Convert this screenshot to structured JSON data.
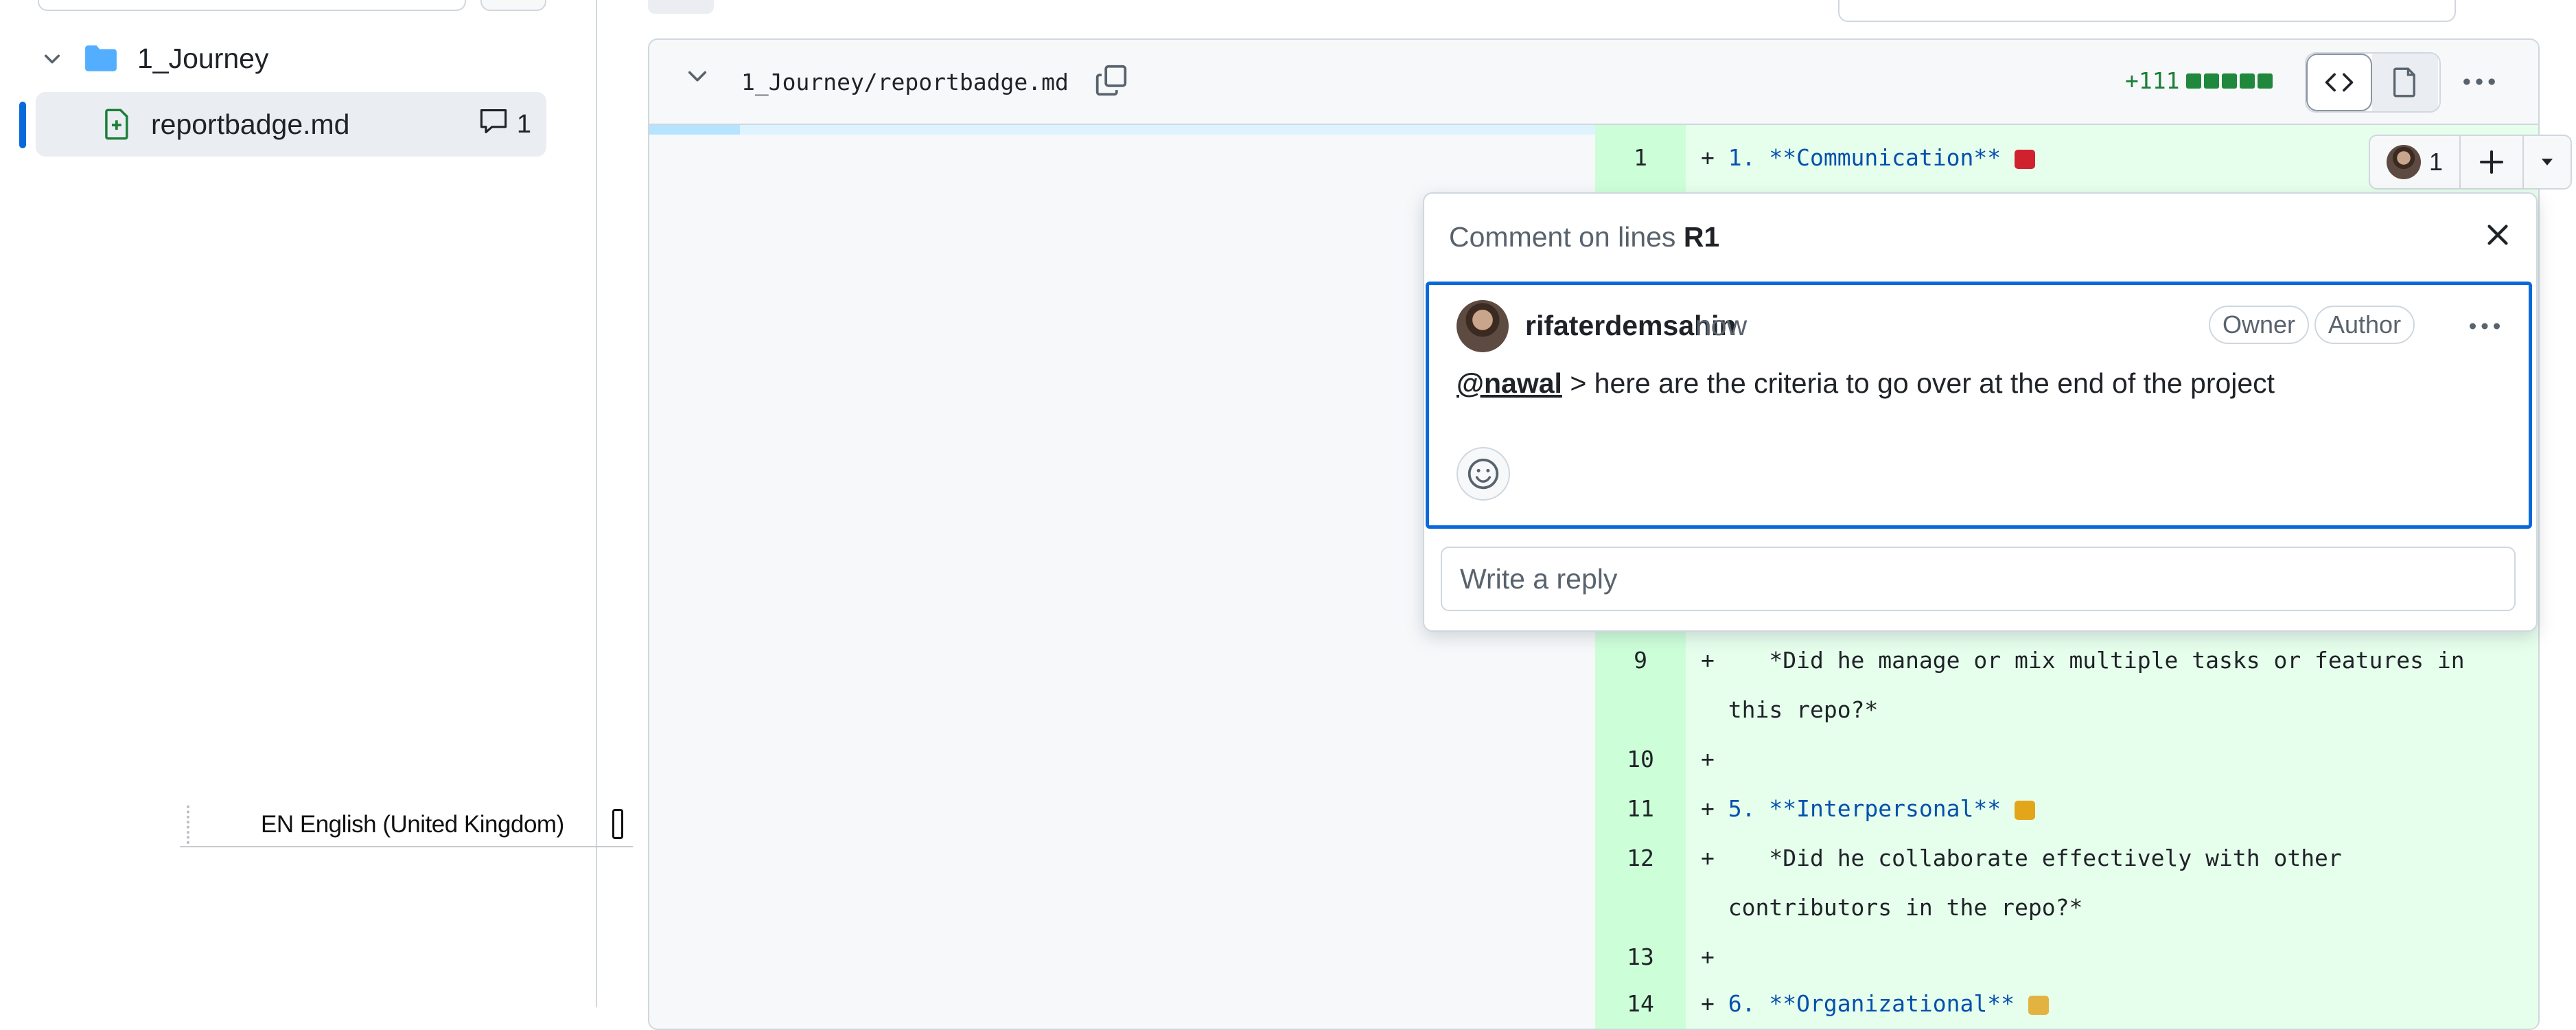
{
  "sidebar": {
    "folder": {
      "name": "1_Journey",
      "icon": "folder-icon"
    },
    "file": {
      "name": "reportbadge.md",
      "icon": "file-added-icon",
      "comment_count": "1"
    },
    "language": {
      "code": "EN",
      "label": "English (United Kingdom)"
    }
  },
  "file": {
    "path": "1_Journey/reportbadge.md",
    "additions": "+111",
    "lines": [
      {
        "num": "1",
        "prefix": "+ ",
        "text": "1. **Communication** ",
        "emoji_color": "#cf222e"
      },
      {
        "num": "9",
        "prefix": "+ ",
        "text": "   *Did he manage or mix multiple tasks or features in"
      },
      {
        "num": "",
        "prefix": "  ",
        "text": "this repo?*"
      },
      {
        "num": "10",
        "prefix": "+ ",
        "text": ""
      },
      {
        "num": "11",
        "prefix": "+ ",
        "text": "5. **Interpersonal** ",
        "emoji_color": "#e3a51a"
      },
      {
        "num": "12",
        "prefix": "+ ",
        "text": "   *Did he collaborate effectively with other"
      },
      {
        "num": "",
        "prefix": "  ",
        "text": "contributors in the repo?*"
      },
      {
        "num": "13",
        "prefix": "+ ",
        "text": ""
      },
      {
        "num": "14",
        "prefix": "+ ",
        "text": "6. **Organizational** ",
        "emoji_color": "#e3b341"
      }
    ],
    "reaction_count": "1"
  },
  "comment_popup": {
    "title_prefix": "Comment on lines ",
    "title_lines": "R1",
    "comment": {
      "author": "rifaterdemsahin",
      "time": "now",
      "badges": [
        "Owner",
        "Author"
      ],
      "mention": "@nawal",
      "body": " > here are the criteria to go over at the end of the project"
    },
    "reply_placeholder": "Write a reply"
  },
  "colors": {
    "accent": "#0969da",
    "added_bg": "#e6ffec",
    "added_num_bg": "#ccffd8",
    "additions": "#1a7f37"
  }
}
